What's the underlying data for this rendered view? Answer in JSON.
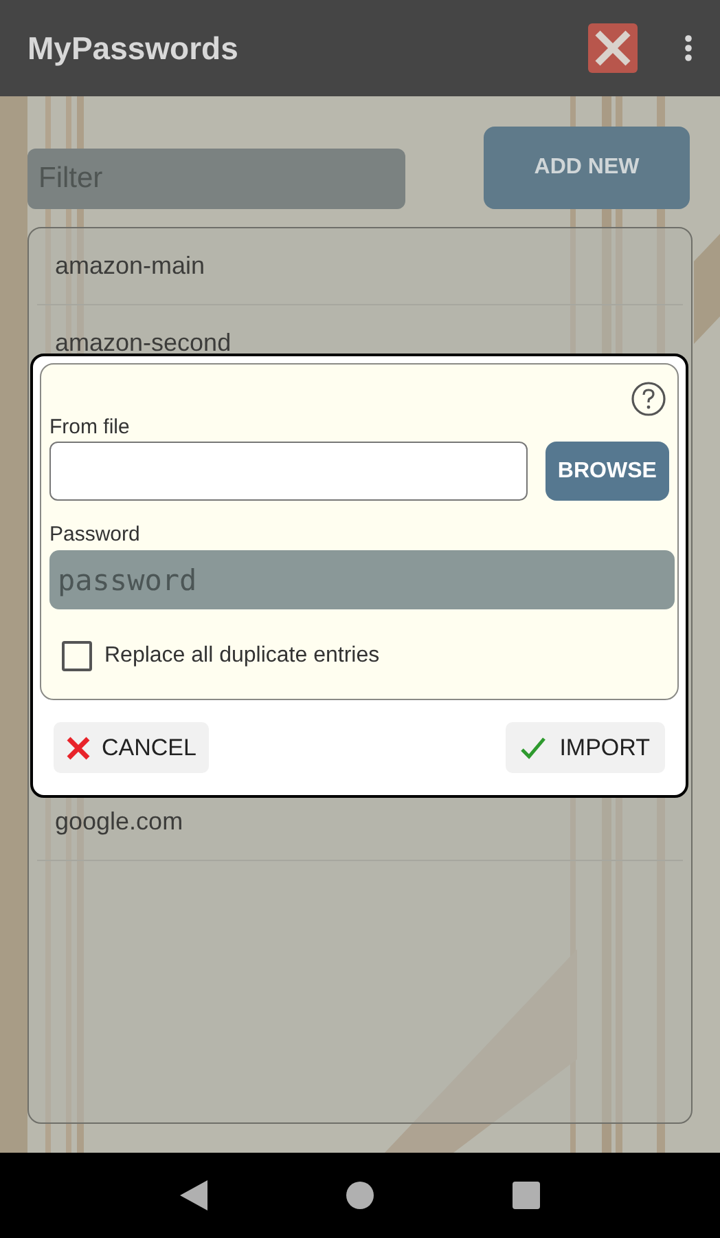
{
  "app_bar": {
    "title": "MyPasswords"
  },
  "filter": {
    "placeholder": "Filter"
  },
  "add_button": {
    "label": "ADD NEW"
  },
  "entries": [
    {
      "name": "amazon-main"
    },
    {
      "name": "amazon-second"
    },
    {
      "name": "google.com"
    }
  ],
  "dialog": {
    "file_label": "From file",
    "browse_label": "BROWSE",
    "password_label": "Password",
    "password_placeholder": "password",
    "replace_duplicates": {
      "label": "Replace all duplicate entries",
      "checked": false
    },
    "cancel_label": "CANCEL",
    "import_label": "IMPORT"
  }
}
